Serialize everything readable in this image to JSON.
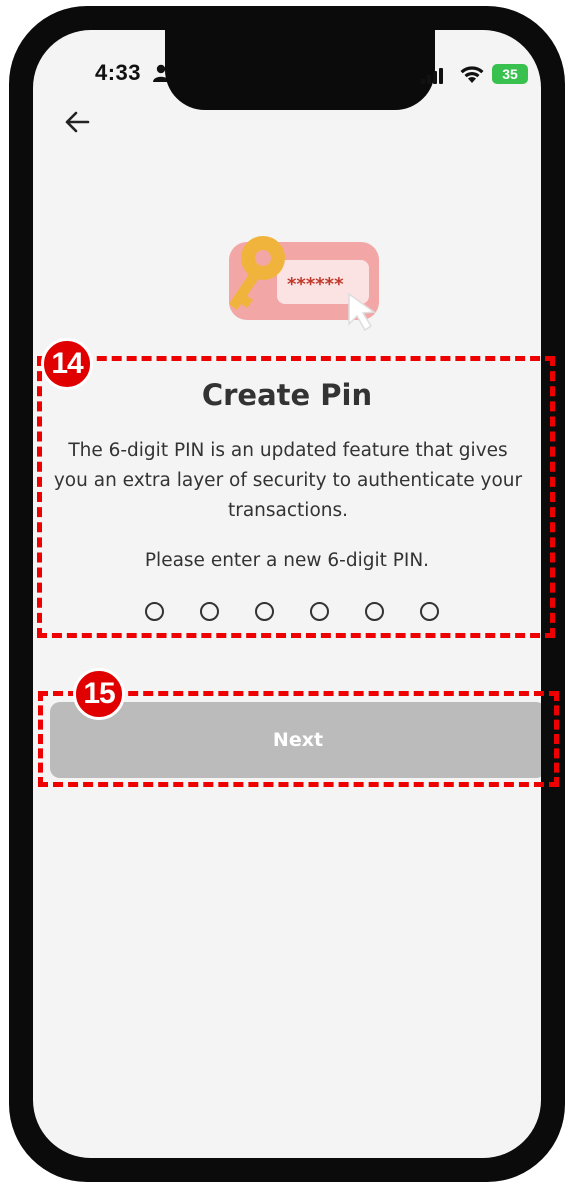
{
  "status_bar": {
    "time": "4:33",
    "battery": "35"
  },
  "illustration": {
    "password_mask": "******"
  },
  "page": {
    "title": "Create Pin",
    "description": "The 6-digit PIN is an updated feature that gives you an extra layer of security to authenticate your transactions.",
    "prompt": "Please enter a new 6-digit PIN.",
    "pin_length": 6,
    "pin_filled": 0
  },
  "next_button": {
    "label": "Next"
  },
  "annotations": {
    "pin_section_number": "14",
    "next_button_number": "15",
    "color": "#ee0000"
  },
  "colors": {
    "background": "#f4f4f4",
    "text": "#333333",
    "button_disabled": "#bbbbbb",
    "battery": "#39c14f"
  }
}
